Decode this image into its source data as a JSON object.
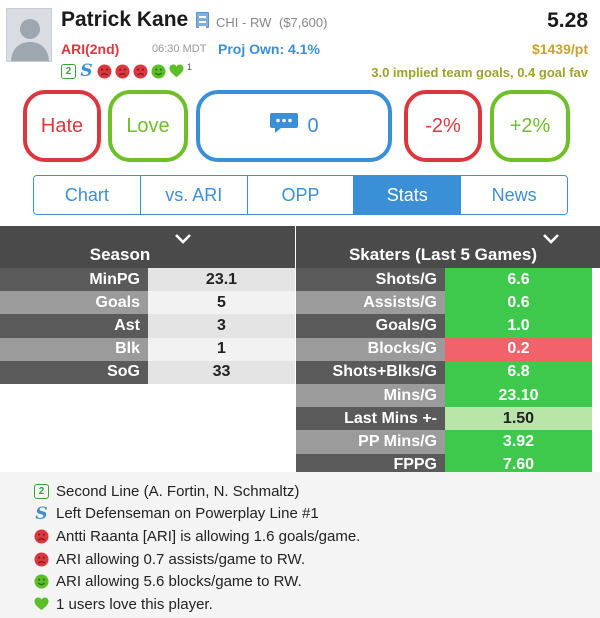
{
  "player": {
    "name": "Patrick Kane",
    "team_pos": "CHI - RW",
    "salary": "($7,600)",
    "projected_points": "5.28",
    "opponent": "ARI(2nd)",
    "game_time": "06:30 MDT",
    "proj_own": "Proj Own: 4.1%",
    "dollar_per_point": "$1439/pt",
    "implied_goals": "3.0 implied team goals, 0.4 goal fav",
    "love_count": "1"
  },
  "icons": [
    "line-2-icon",
    "powerplay-icon",
    "sad-face-icon",
    "sad-face-icon",
    "sad-face-icon",
    "smile-face-icon",
    "heart-icon"
  ],
  "colors": {
    "red": "#d9393e",
    "green": "#6fbf2a",
    "blue": "#3b8fd6",
    "gold": "#c9a32e",
    "olive": "#9aa52a",
    "stat_green": "#3ec84c",
    "stat_light_green": "#b8e6a8",
    "stat_red": "#f2626a"
  },
  "actions": {
    "hate": "Hate",
    "love": "Love",
    "comment_count": "0",
    "minus": "-2%",
    "plus": "+2%"
  },
  "tabs": [
    {
      "label": "Chart",
      "active": false
    },
    {
      "label": "vs. ARI",
      "active": false
    },
    {
      "label": "OPP",
      "active": false
    },
    {
      "label": "Stats",
      "active": true
    },
    {
      "label": "News",
      "active": false
    }
  ],
  "season": {
    "title": "Season",
    "rows": [
      {
        "label": "MinPG",
        "value": "23.1"
      },
      {
        "label": "Goals",
        "value": "5"
      },
      {
        "label": "Ast",
        "value": "3"
      },
      {
        "label": "Blk",
        "value": "1"
      },
      {
        "label": "SoG",
        "value": "33"
      }
    ]
  },
  "skaters": {
    "title": "Skaters (Last 5 Games)",
    "rows": [
      {
        "label": "Shots/G",
        "value": "6.6",
        "status": "good"
      },
      {
        "label": "Assists/G",
        "value": "0.6",
        "status": "good"
      },
      {
        "label": "Goals/G",
        "value": "1.0",
        "status": "good"
      },
      {
        "label": "Blocks/G",
        "value": "0.2",
        "status": "bad"
      },
      {
        "label": "Shots+Blks/G",
        "value": "6.8",
        "status": "good"
      },
      {
        "label": "Mins/G",
        "value": "23.10",
        "status": "good"
      },
      {
        "label": "Last Mins +-",
        "value": "1.50",
        "status": "neutral"
      },
      {
        "label": "PP Mins/G",
        "value": "3.92",
        "status": "good"
      },
      {
        "label": "FPPG",
        "value": "7.60",
        "status": "good"
      }
    ]
  },
  "notes": [
    {
      "icon": "line-2-icon",
      "text": "Second Line (A. Fortin, N. Schmaltz)"
    },
    {
      "icon": "powerplay-icon",
      "text": "Left Defenseman on Powerplay Line #1"
    },
    {
      "icon": "sad-face-icon",
      "text": "Antti Raanta [ARI] is allowing 1.6 goals/game."
    },
    {
      "icon": "sad-face-icon",
      "text": "ARI allowing 0.7 assists/game to RW."
    },
    {
      "icon": "smile-face-icon",
      "text": "ARI allowing 5.6 blocks/game to RW."
    },
    {
      "icon": "heart-icon",
      "text": "1 users love this player."
    }
  ]
}
